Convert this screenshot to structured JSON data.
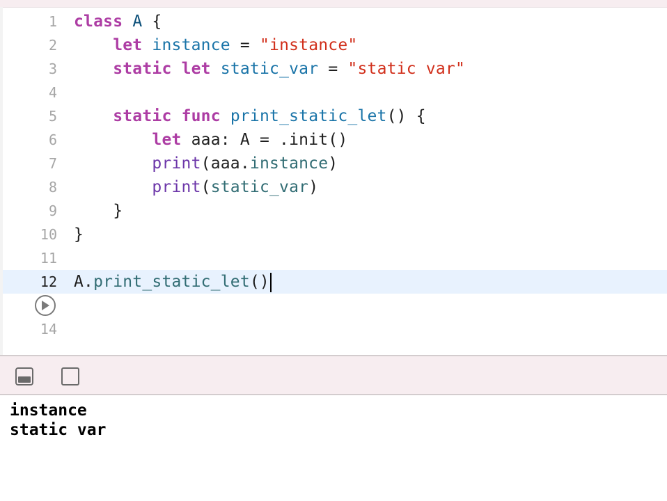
{
  "editor": {
    "line_numbers": [
      "1",
      "2",
      "3",
      "4",
      "5",
      "6",
      "7",
      "8",
      "9",
      "10",
      "11",
      "12",
      "14"
    ],
    "current_line": "12",
    "lines": [
      [
        {
          "t": "class",
          "c": "kw"
        },
        {
          "t": " ",
          "c": "pl"
        },
        {
          "t": "A",
          "c": "ty"
        },
        {
          "t": " {",
          "c": "pl"
        }
      ],
      [
        {
          "t": "    ",
          "c": "pl"
        },
        {
          "t": "let",
          "c": "kw"
        },
        {
          "t": " ",
          "c": "pl"
        },
        {
          "t": "instance",
          "c": "id"
        },
        {
          "t": " = ",
          "c": "pl"
        },
        {
          "t": "\"instance\"",
          "c": "str"
        }
      ],
      [
        {
          "t": "    ",
          "c": "pl"
        },
        {
          "t": "static",
          "c": "kw"
        },
        {
          "t": " ",
          "c": "pl"
        },
        {
          "t": "let",
          "c": "kw"
        },
        {
          "t": " ",
          "c": "pl"
        },
        {
          "t": "static_var",
          "c": "id"
        },
        {
          "t": " = ",
          "c": "pl"
        },
        {
          "t": "\"static var\"",
          "c": "str"
        }
      ],
      [],
      [
        {
          "t": "    ",
          "c": "pl"
        },
        {
          "t": "static",
          "c": "kw"
        },
        {
          "t": " ",
          "c": "pl"
        },
        {
          "t": "func",
          "c": "kw"
        },
        {
          "t": " ",
          "c": "pl"
        },
        {
          "t": "print_static_let",
          "c": "id"
        },
        {
          "t": "() {",
          "c": "pl"
        }
      ],
      [
        {
          "t": "        ",
          "c": "pl"
        },
        {
          "t": "let",
          "c": "kw"
        },
        {
          "t": " aaa: ",
          "c": "pl"
        },
        {
          "t": "A",
          "c": "pl"
        },
        {
          "t": " = .init()",
          "c": "pl"
        }
      ],
      [
        {
          "t": "        ",
          "c": "pl"
        },
        {
          "t": "print",
          "c": "sys"
        },
        {
          "t": "(aaa.",
          "c": "pl"
        },
        {
          "t": "instance",
          "c": "fn"
        },
        {
          "t": ")",
          "c": "pl"
        }
      ],
      [
        {
          "t": "        ",
          "c": "pl"
        },
        {
          "t": "print",
          "c": "sys"
        },
        {
          "t": "(",
          "c": "pl"
        },
        {
          "t": "static_var",
          "c": "fn"
        },
        {
          "t": ")",
          "c": "pl"
        }
      ],
      [
        {
          "t": "    }",
          "c": "pl"
        }
      ],
      [
        {
          "t": "}",
          "c": "pl"
        }
      ],
      [],
      [
        {
          "t": "A.",
          "c": "pl"
        },
        {
          "t": "print_static_let",
          "c": "fn"
        },
        {
          "t": "()",
          "c": "pl"
        }
      ],
      []
    ]
  },
  "run_button_icon": "play-circle-icon",
  "toolbar": {
    "icons": [
      "debug-area-toggle-icon",
      "console-toggle-icon"
    ]
  },
  "console": {
    "output": [
      "instance",
      "static var"
    ]
  },
  "colors": {
    "keyword": "#ad3da4",
    "type": "#0b4f79",
    "identifier": "#1a74a8",
    "string": "#d12f1b",
    "function": "#326d74",
    "system": "#6c36a9",
    "current_line_bg": "#e8f2fe",
    "chrome_bg": "#f7edf0"
  }
}
